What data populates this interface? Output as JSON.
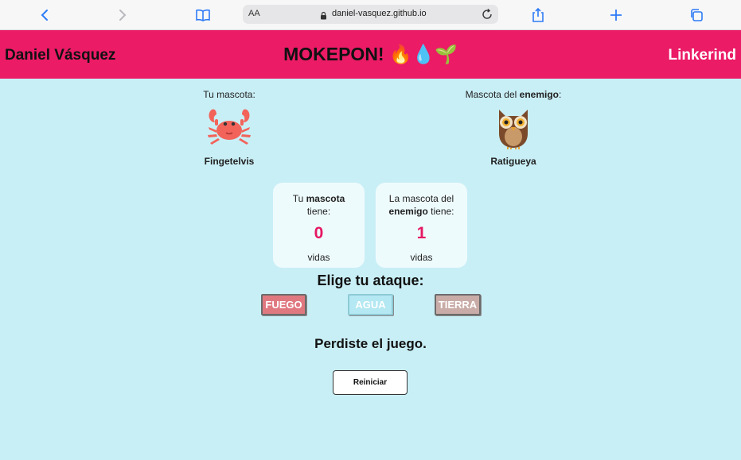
{
  "browser": {
    "aa_label": "AA",
    "url": "daniel-vasquez.github.io"
  },
  "header": {
    "author": "Daniel Vásquez",
    "title": "MOKEPON! 🔥💧🌱",
    "link": "Linkerind"
  },
  "player": {
    "caption": "Tu mascota:",
    "pet_name": "Fingetelvis",
    "pet_icon": "crab-icon"
  },
  "enemy": {
    "caption_prefix": "Mascota del ",
    "caption_bold": "enemigo",
    "caption_suffix": ":",
    "pet_name": "Ratigueya",
    "pet_icon": "owl-icon"
  },
  "lives": {
    "player": {
      "line1_prefix": "Tu ",
      "line1_bold": "mascota",
      "line2": "tiene:",
      "count": "0",
      "unit": "vidas"
    },
    "enemy": {
      "line1": "La mascota del",
      "line2_bold": "enemigo",
      "line2_suffix": " tiene:",
      "count": "1",
      "unit": "vidas"
    }
  },
  "attack": {
    "title": "Elige tu ataque:",
    "buttons": [
      "FUEGO",
      "AGUA",
      "TIERRA"
    ]
  },
  "result": "Perdiste el juego.",
  "restart_label": "Reiniciar",
  "colors": {
    "header": "#eb1b66",
    "background": "#c9eff6",
    "lives_number": "#e61862"
  }
}
